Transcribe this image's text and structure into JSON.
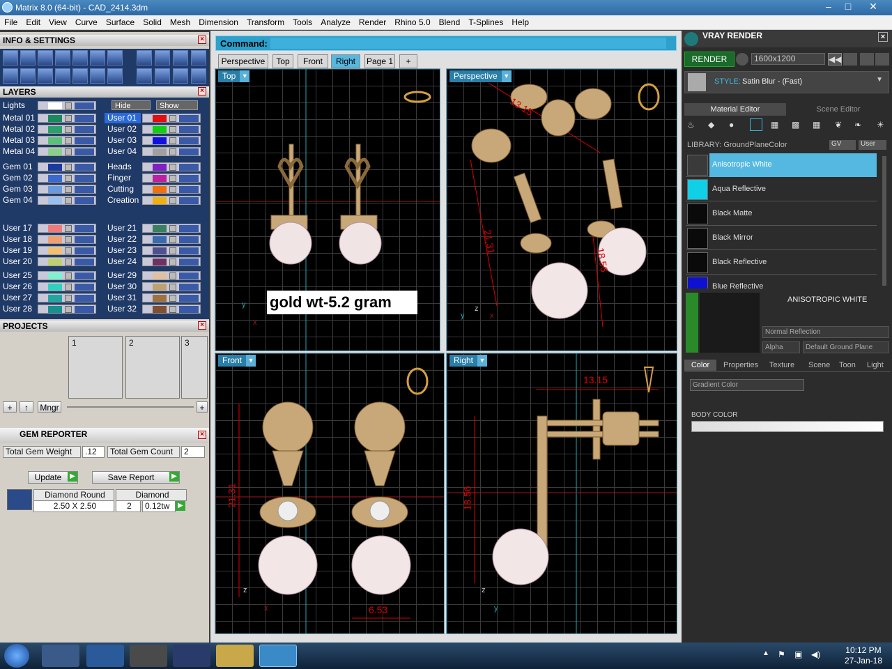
{
  "window": {
    "title": "Matrix 8.0 (64-bit) - CAD_2414.3dm",
    "minimize": "–",
    "maximize": "□",
    "close": "✕"
  },
  "menu": [
    "File",
    "Edit",
    "View",
    "Curve",
    "Surface",
    "Solid",
    "Mesh",
    "Dimension",
    "Transform",
    "Tools",
    "Analyze",
    "Render",
    "Rhino 5.0",
    "Blend",
    "T-Splines",
    "Help"
  ],
  "info": {
    "title": "INFO & SETTINGS"
  },
  "layers": {
    "title": "LAYERS",
    "lights": "Lights",
    "hide": "Hide",
    "show": "Show",
    "left": [
      {
        "name": "Metal 01",
        "color": "#1a8a5a"
      },
      {
        "name": "Metal 02",
        "color": "#2aa06a"
      },
      {
        "name": "Metal 03",
        "color": "#5ac07a"
      },
      {
        "name": "Metal 04",
        "color": "#8ad08a"
      },
      {
        "name": "Gem 01",
        "color": "#1a3aa0"
      },
      {
        "name": "Gem 02",
        "color": "#3a6ad0"
      },
      {
        "name": "Gem 03",
        "color": "#6a9ae0"
      },
      {
        "name": "Gem 04",
        "color": "#9ac0f0"
      },
      {
        "name": "User 17",
        "color": "#f07a7a"
      },
      {
        "name": "User 18",
        "color": "#f0a070"
      },
      {
        "name": "User 19",
        "color": "#f0c070"
      },
      {
        "name": "User 20",
        "color": "#c0d070"
      },
      {
        "name": "User 25",
        "color": "#80f0d0"
      },
      {
        "name": "User 26",
        "color": "#30d0c0"
      },
      {
        "name": "User 27",
        "color": "#20a8a0"
      },
      {
        "name": "User 28",
        "color": "#189090"
      }
    ],
    "right": [
      {
        "name": "User 01",
        "color": "#e01010"
      },
      {
        "name": "User 02",
        "color": "#10d010"
      },
      {
        "name": "User 03",
        "color": "#1010e0"
      },
      {
        "name": "User 04",
        "color": "#a0a0a0"
      },
      {
        "name": "Heads",
        "color": "#8020c0"
      },
      {
        "name": "Finger",
        "color": "#c020a0"
      },
      {
        "name": "Cutting",
        "color": "#f07010"
      },
      {
        "name": "Creation",
        "color": "#f0b010"
      },
      {
        "name": "User 21",
        "color": "#3a8060"
      },
      {
        "name": "User 22",
        "color": "#3a6ab0"
      },
      {
        "name": "User 23",
        "color": "#505090"
      },
      {
        "name": "User 24",
        "color": "#703060"
      },
      {
        "name": "User 29",
        "color": "#e0c0a0"
      },
      {
        "name": "User 30",
        "color": "#c0a070"
      },
      {
        "name": "User 31",
        "color": "#a07040"
      },
      {
        "name": "User 32",
        "color": "#805030"
      }
    ]
  },
  "projects": {
    "title": "PROJECTS",
    "cells": [
      "1",
      "2",
      "3"
    ],
    "mngr": "Mngr",
    "plus": "+"
  },
  "gem": {
    "title": "GEM REPORTER",
    "weight_label": "Total Gem Weight",
    "weight": ".12",
    "count_label": "Total Gem Count",
    "count": "2",
    "update": "Update",
    "save": "Save Report",
    "row": {
      "shape": "Diamond Round",
      "type": "Diamond",
      "size": "2.50 X 2.50",
      "qty": "2",
      "tw": "0.12tw"
    }
  },
  "command": {
    "label": "Command:"
  },
  "tabs": [
    "Perspective",
    "Top",
    "Front",
    "Right",
    "Page 1"
  ],
  "tab_add": "+",
  "viewports": {
    "top": "Top",
    "perspective": "Perspective",
    "front": "Front",
    "right": "Right"
  },
  "note": "gold wt-5.2 gram",
  "dims": {
    "persp_a": "13.15",
    "persp_b": "21.31",
    "persp_c": "18.56",
    "front_h": "21.31",
    "front_w": "6.53",
    "right_w": "13.15",
    "right_h": "18.56"
  },
  "axes": {
    "x": "x",
    "y": "y",
    "z": "z"
  },
  "vray": {
    "title": "VRAY RENDER",
    "render": "RENDER",
    "resolution": "1600x1200",
    "style_label": "STYLE:",
    "style": "Satin Blur - (Fast)",
    "mat_editor": "Material Editor",
    "scene_editor": "Scene Editor",
    "library": "LIBRARY: GroundPlaneColor",
    "gv": "GV",
    "user": "User",
    "materials": [
      {
        "name": "Anisotropic White",
        "color": "#3a3a3a"
      },
      {
        "name": "Aqua Reflective",
        "color": "#10d0e8"
      },
      {
        "name": "Black Matte",
        "color": "#0a0a0a"
      },
      {
        "name": "Black Mirror",
        "color": "#0a0a0a"
      },
      {
        "name": "Black Reflective",
        "color": "#0a0a0a"
      },
      {
        "name": "Blue Reflective",
        "color": "#1010d0"
      }
    ],
    "selected": "ANISOTROPIC WHITE",
    "refl": "Normal Reflection",
    "alpha": "Alpha",
    "ground": "Default Ground Plane",
    "subtabs": [
      "Color",
      "Properties",
      "Texture",
      "Scene",
      "Toon",
      "Light"
    ],
    "gradient": "Gradient Color",
    "body": "BODY COLOR"
  },
  "clock": {
    "time": "10:12 PM",
    "date": "27-Jan-18"
  },
  "accent": "#55b8e0"
}
